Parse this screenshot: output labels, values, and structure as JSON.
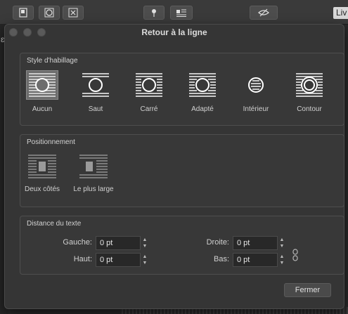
{
  "background": {
    "toolbar_live_label": "Liv",
    "side_glyph": "ɛ"
  },
  "dialog": {
    "title": "Retour à la ligne",
    "wrap_style": {
      "heading": "Style d'habillage",
      "options": [
        {
          "label": "Aucun",
          "icon": "wrap-none-icon",
          "selected": true
        },
        {
          "label": "Saut",
          "icon": "wrap-jump-icon",
          "selected": false
        },
        {
          "label": "Carré",
          "icon": "wrap-square-icon",
          "selected": false
        },
        {
          "label": "Adapté",
          "icon": "wrap-tight-icon",
          "selected": false
        },
        {
          "label": "Intérieur",
          "icon": "wrap-inside-icon",
          "selected": false
        },
        {
          "label": "Contour",
          "icon": "wrap-contour-icon",
          "selected": false
        }
      ]
    },
    "positioning": {
      "heading": "Positionnement",
      "options": [
        {
          "label": "Deux côtés",
          "icon": "both-sides-icon"
        },
        {
          "label": "Le plus large",
          "icon": "largest-side-icon"
        }
      ]
    },
    "distance": {
      "heading": "Distance du texte",
      "left_label": "Gauche:",
      "left_value": "0 pt",
      "top_label": "Haut:",
      "top_value": "0 pt",
      "right_label": "Droite:",
      "right_value": "0 pt",
      "bottom_label": "Bas:",
      "bottom_value": "0 pt"
    },
    "close_label": "Fermer"
  },
  "colors": {
    "dialog_bg": "#353535",
    "group_bg": "#383838",
    "selected_bg": "#6d6d6d",
    "input_bg": "#282828"
  }
}
